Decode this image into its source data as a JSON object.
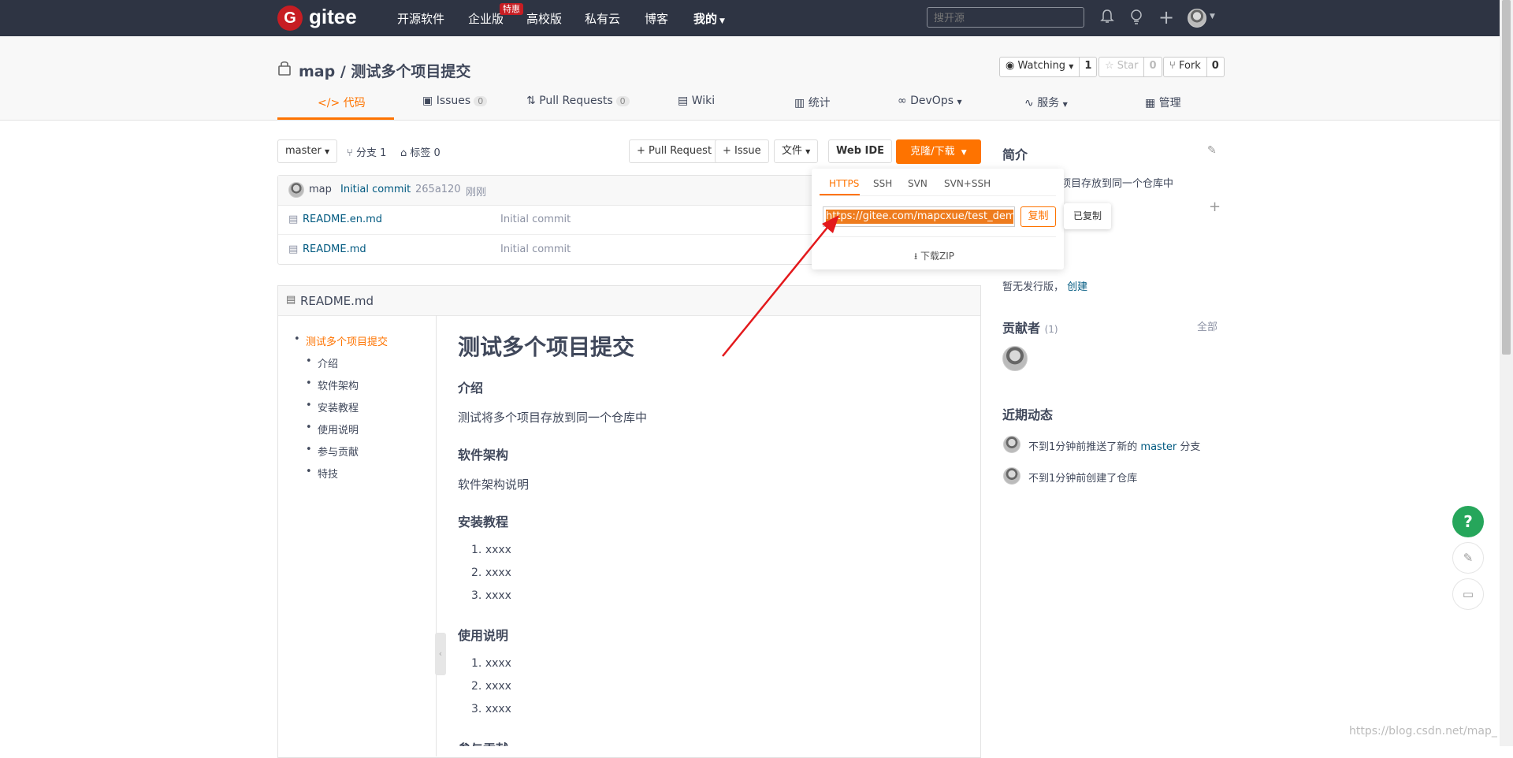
{
  "nav": {
    "logo_letter": "G",
    "logo_text": "gitee",
    "items": [
      "开源软件",
      "企业版",
      "高校版",
      "私有云",
      "博客",
      "我的"
    ],
    "hot_badge": "特惠",
    "search_placeholder": "搜开源"
  },
  "repo": {
    "owner": "map",
    "name": "测试多个项目提交",
    "watching_label": "Watching",
    "watching_count": "1",
    "star_label": "Star",
    "star_count": "0",
    "fork_label": "Fork",
    "fork_count": "0"
  },
  "tabs": [
    {
      "label": "代码",
      "count": ""
    },
    {
      "label": "Issues",
      "count": "0"
    },
    {
      "label": "Pull Requests",
      "count": "0"
    },
    {
      "label": "Wiki",
      "count": ""
    },
    {
      "label": "统计",
      "count": ""
    },
    {
      "label": "DevOps",
      "count": ""
    },
    {
      "label": "服务",
      "count": ""
    },
    {
      "label": "管理",
      "count": ""
    }
  ],
  "toolbar": {
    "branch": "master",
    "branches": "分支 1",
    "tags": "标签 0",
    "pull_request": "+ Pull Request",
    "issue": "+ Issue",
    "file": "文件",
    "web_ide": "Web IDE",
    "clone": "克隆/下载"
  },
  "commit": {
    "author": "map",
    "message": "Initial commit",
    "hash": "265a120",
    "time": "刚刚"
  },
  "files": [
    {
      "name": "README.en.md",
      "commit": "Initial commit"
    },
    {
      "name": "README.md",
      "commit": "Initial commit"
    }
  ],
  "clone_dropdown": {
    "tabs": [
      "HTTPS",
      "SSH",
      "SVN",
      "SVN+SSH"
    ],
    "url": "https://gitee.com/mapcxue/test_demo",
    "copy_label": "复制",
    "copied_tip": "已复制",
    "download_zip": "下载ZIP"
  },
  "readme": {
    "filename": "README.md",
    "toc": [
      "测试多个项目提交",
      "介绍",
      "软件架构",
      "安装教程",
      "使用说明",
      "参与贡献",
      "特技"
    ],
    "h1": "测试多个项目提交",
    "intro_h": "介绍",
    "intro_p": "测试将多个项目存放到同一个仓库中",
    "arch_h": "软件架构",
    "arch_p": "软件架构说明",
    "install_h": "安装教程",
    "install_items": [
      "xxxx",
      "xxxx",
      "xxxx"
    ],
    "usage_h": "使用说明",
    "usage_items": [
      "xxxx",
      "xxxx",
      "xxxx"
    ],
    "contrib_h": "参与贡献"
  },
  "sidebar": {
    "intro_title": "简介",
    "intro_text": "项目存放到同一个仓库中",
    "release_text": "暂无发行版，",
    "release_link": "创建",
    "contributors_title": "贡献者",
    "contributors_count": "(1)",
    "contributors_all": "全部",
    "activity_title": "近期动态",
    "activity": [
      {
        "pre": "不到1分钟前推送了新的",
        "branch": "master",
        "post": "分支"
      },
      {
        "pre": "不到1分钟前创建了仓库",
        "branch": "",
        "post": ""
      }
    ]
  },
  "float": {
    "help": "?"
  },
  "watermark": "https://blog.csdn.net/map_c",
  "colors": {
    "accent": "#fe7300",
    "nav_bg": "#2e3443",
    "link": "#005980",
    "help": "#26a65b"
  }
}
